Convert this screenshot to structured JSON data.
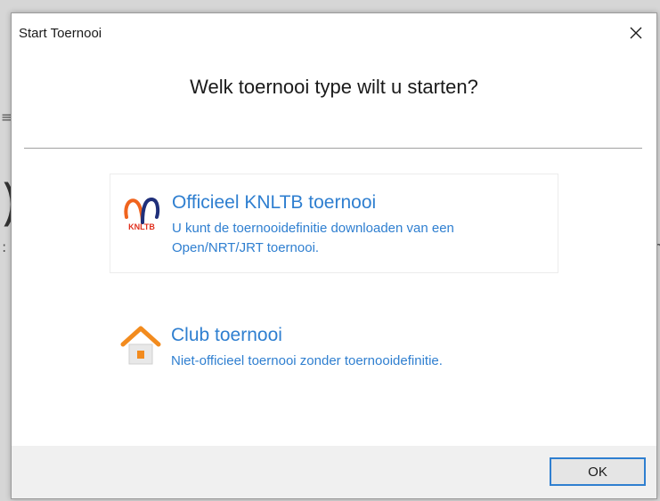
{
  "dialog": {
    "title": "Start Toernooi",
    "heading": "Welk toernooi type wilt u starten?"
  },
  "options": [
    {
      "title": "Officieel KNLTB toernooi",
      "description": "U kunt de toernooidefinitie downloaden van een Open/NRT/JRT toernooi.",
      "icon": "knltb-logo",
      "logo_text": "KNLTB"
    },
    {
      "title": "Club toernooi",
      "description": "Niet-officieel toernooi zonder toernooidefinitie.",
      "icon": "house-icon"
    }
  ],
  "footer": {
    "ok_label": "OK"
  },
  "colors": {
    "link_blue": "#2f7fd0",
    "knltb_orange": "#f0641e",
    "knltb_navy": "#1f2f7a",
    "house_orange": "#f28b1e"
  }
}
